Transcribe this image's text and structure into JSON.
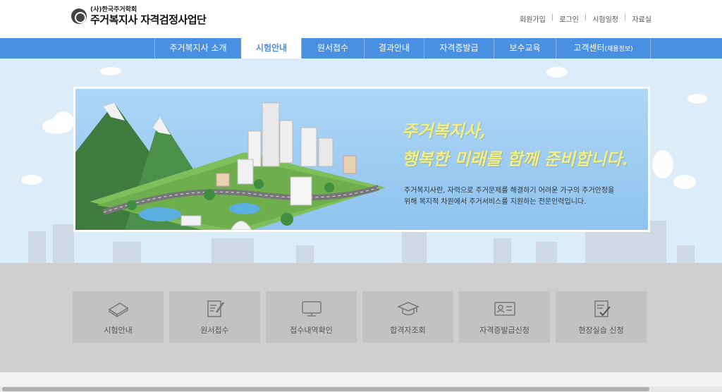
{
  "logo": {
    "org": "(사)한국주거학회",
    "title": "주거복지사 자격검정사업단"
  },
  "util_links": [
    "회원가입",
    "로그인",
    "시험일정",
    "자료실"
  ],
  "nav": {
    "items": [
      {
        "label": "주거복지사 소개"
      },
      {
        "label": "시험안내",
        "active": true
      },
      {
        "label": "원서접수"
      },
      {
        "label": "결과안내"
      },
      {
        "label": "자격증발급"
      },
      {
        "label": "보수교육"
      },
      {
        "label": "고객센터",
        "suffix": "(채용정보)"
      }
    ],
    "color": "#4a90e2"
  },
  "banner": {
    "slogan_line1": "주거복지사,",
    "slogan_line2": "행복한 미래를 함께 준비합니다.",
    "desc_line1": "주거복지사란, 자력으로 주거문제를 해결하기 어려운 가구의 주거안정을",
    "desc_line2": "위해 복지적 차원에서 주거서비스를 지원하는 전문인력입니다."
  },
  "quick_menu": [
    {
      "label": "시험안내",
      "icon": "book-icon"
    },
    {
      "label": "원서접수",
      "icon": "form-pen-icon"
    },
    {
      "label": "접수내역확인",
      "icon": "monitor-icon"
    },
    {
      "label": "합격자조회",
      "icon": "graduation-cap-icon"
    },
    {
      "label": "자격증발급신청",
      "icon": "id-card-icon"
    },
    {
      "label": "현장실습 신청",
      "icon": "checklist-icon"
    }
  ]
}
